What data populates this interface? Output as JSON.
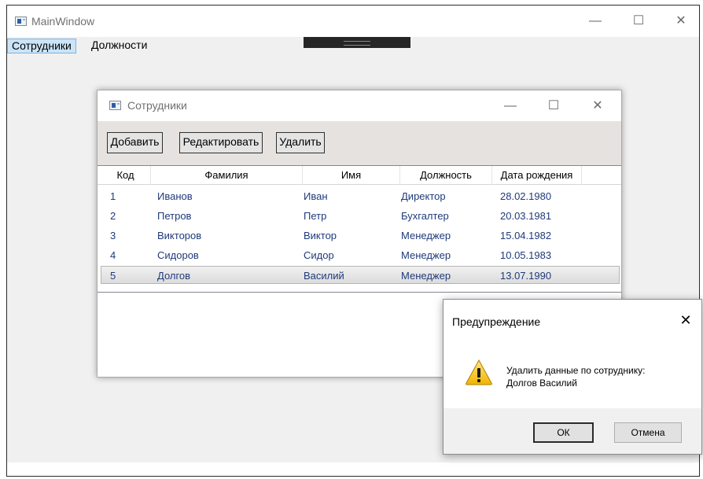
{
  "main_window": {
    "title": "MainWindow",
    "controls": {
      "minimize": "—",
      "maximize": "☐",
      "close": "✕"
    },
    "menu": {
      "employees": "Сотрудники",
      "positions": "Должности"
    }
  },
  "child_window": {
    "title": "Сотрудники",
    "controls": {
      "minimize": "—",
      "maximize": "☐",
      "close": "✕"
    },
    "toolbar": {
      "add": "Добавить",
      "edit": "Редактировать",
      "delete": "Удалить"
    },
    "grid": {
      "columns": [
        "Код",
        "Фамилия",
        "Имя",
        "Должность",
        "Дата рождения"
      ],
      "rows": [
        [
          "1",
          "Иванов",
          "Иван",
          "Директор",
          "28.02.1980"
        ],
        [
          "2",
          "Петров",
          "Петр",
          "Бухгалтер",
          "20.03.1981"
        ],
        [
          "3",
          "Викторов",
          "Виктор",
          "Менеджер",
          "15.04.1982"
        ],
        [
          "4",
          "Сидоров",
          "Сидор",
          "Менеджер",
          "10.05.1983"
        ],
        [
          "5",
          "Долгов",
          "Василий",
          "Менеджер",
          "13.07.1990"
        ]
      ],
      "selected_row": 4
    }
  },
  "dialog": {
    "title": "Предупреждение",
    "close": "✕",
    "message_line1": "Удалить данные по сотруднику:",
    "message_line2": "Долгов Василий",
    "ok": "ОК",
    "cancel": "Отмена",
    "icon": "warning-icon"
  }
}
